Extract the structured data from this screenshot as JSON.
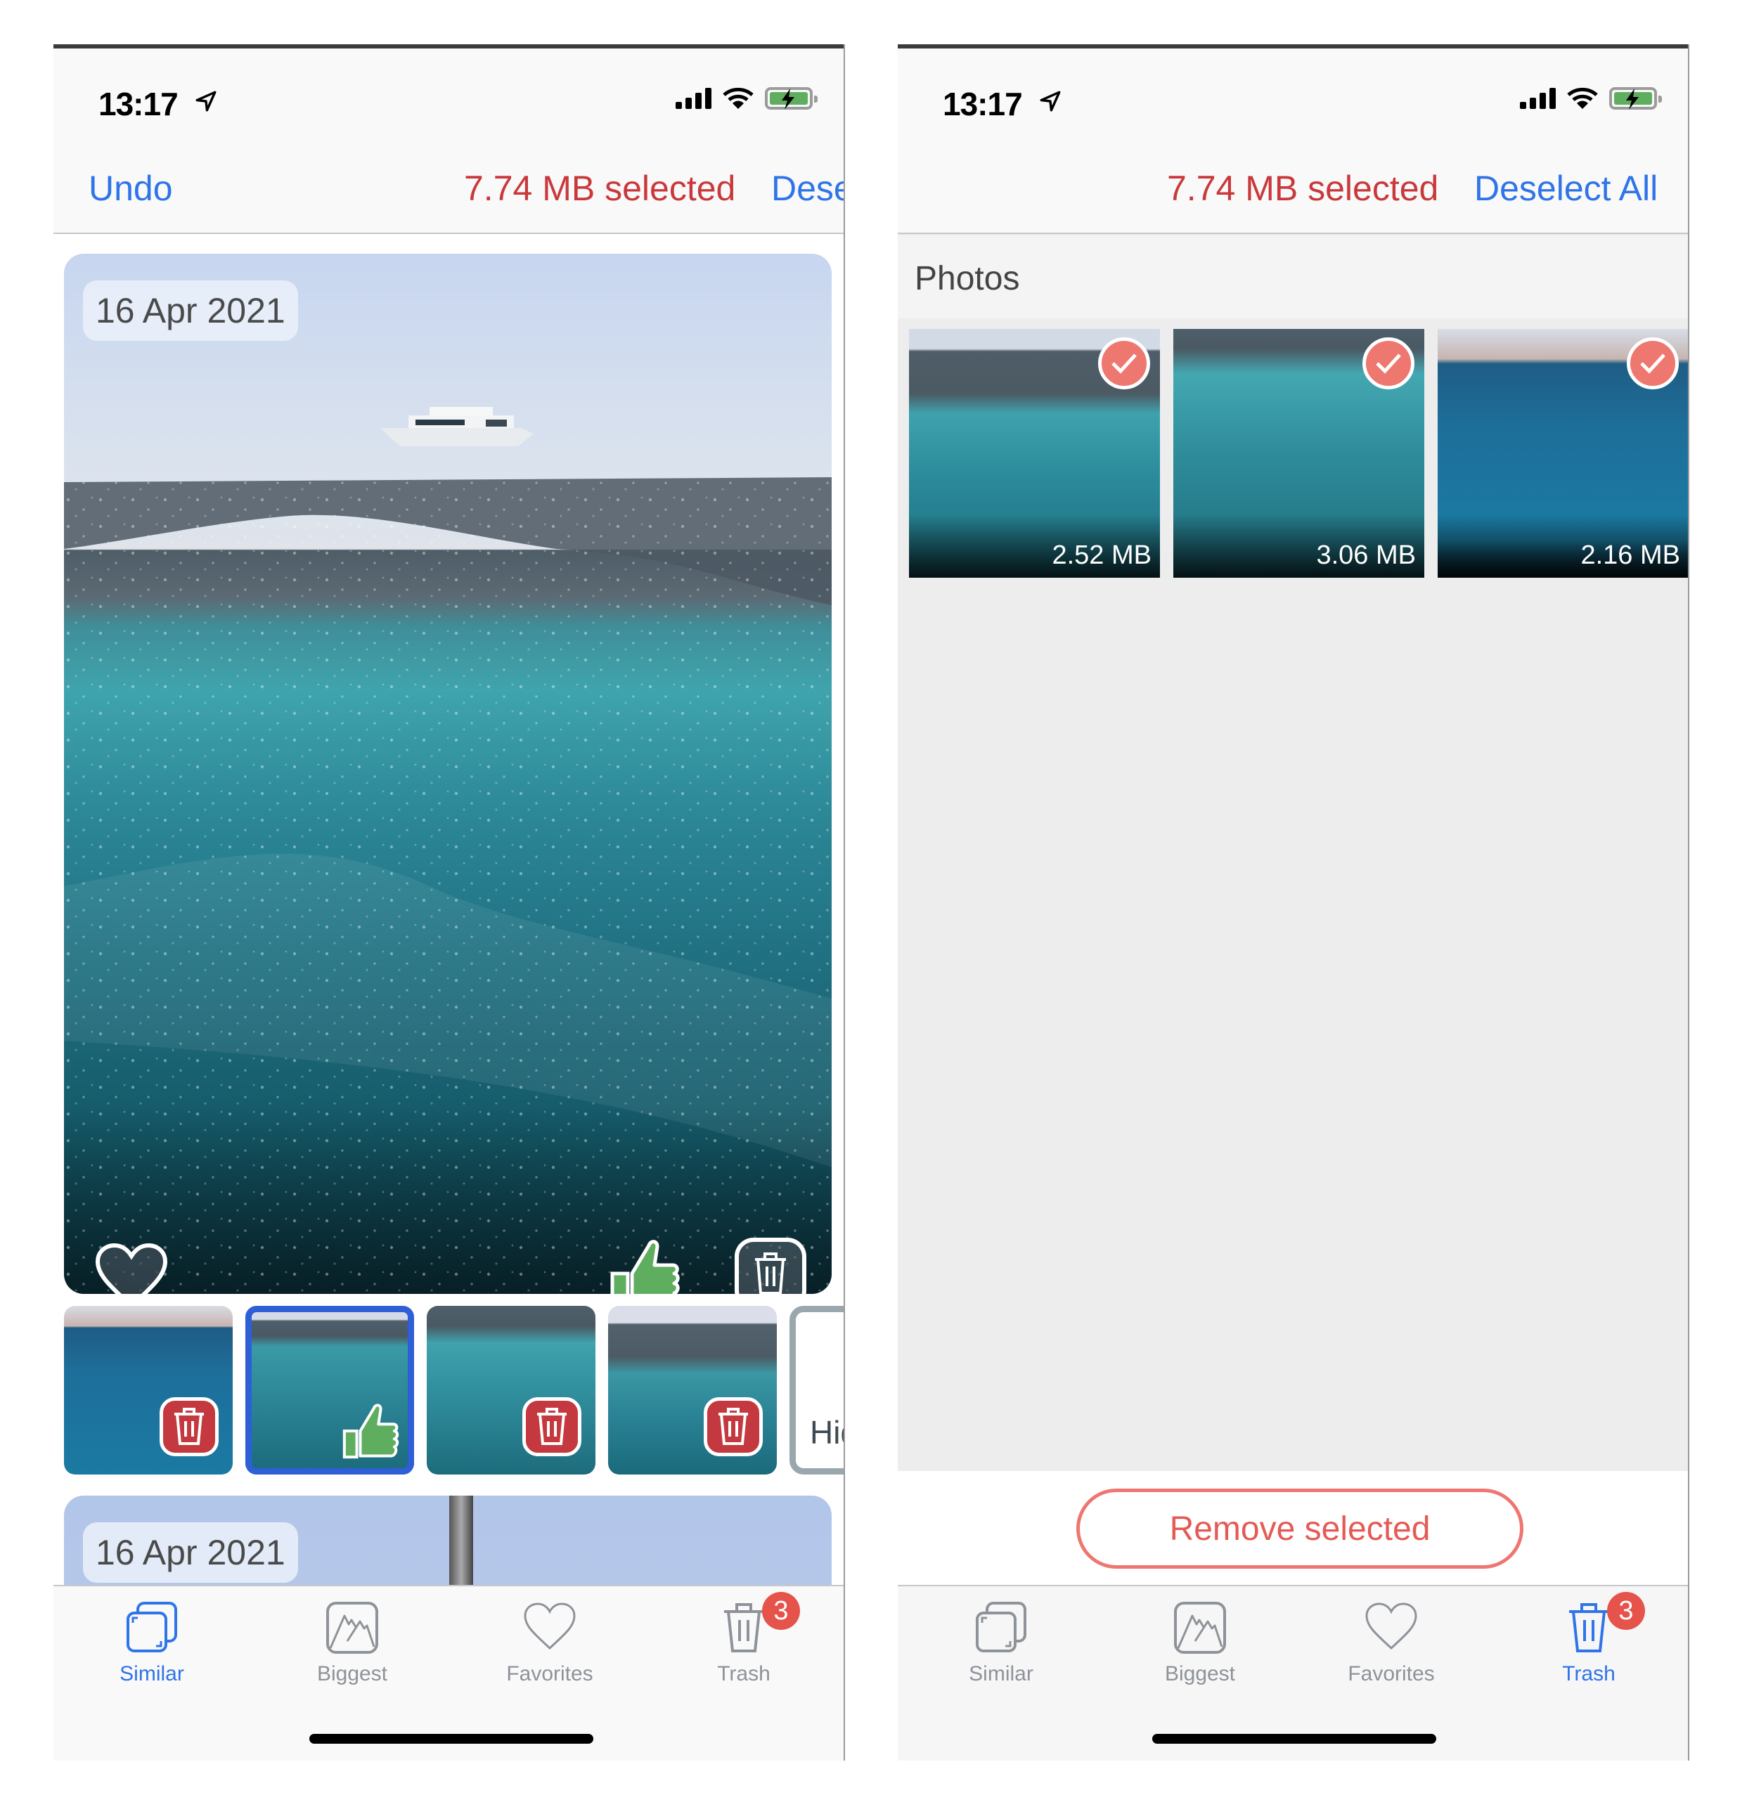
{
  "status_bar": {
    "time": "13:17",
    "location_icon": "location-arrow-icon",
    "signal_icon": "cellular-signal-icon",
    "wifi_icon": "wifi-icon",
    "battery_icon": "battery-charging-icon"
  },
  "colors": {
    "accent_blue": "#2f74e8",
    "selected_red": "#c9393c",
    "remove_red": "#e55a55",
    "check_red": "#ee7870",
    "badge_red": "#e5534b",
    "keep_green": "#5fae5f",
    "trash_badge_red": "#c4393f",
    "selected_border": "#2f5fd6",
    "inactive_gray": "#8e9399"
  },
  "left_screen": {
    "nav": {
      "undo_label": "Undo",
      "selected_size": "7.74 MB selected",
      "deselect_label": "Deselect All"
    },
    "cards": [
      {
        "date": "16 Apr 2021",
        "actions": [
          "favorite-heart",
          "keep-thumbs-up",
          "delete-trash"
        ]
      },
      {
        "date": "16 Apr 2021"
      }
    ],
    "thumbnails": [
      {
        "state": "trash",
        "selected": false
      },
      {
        "state": "keep",
        "selected": true
      },
      {
        "state": "trash",
        "selected": false
      },
      {
        "state": "trash",
        "selected": false
      }
    ],
    "hide_card_label": "Hid",
    "active_tab": "Similar"
  },
  "right_screen": {
    "nav": {
      "selected_size": "7.74 MB selected",
      "deselect_label": "Deselect All"
    },
    "section_title": "Photos",
    "photos": [
      {
        "size": "2.52 MB",
        "checked": true
      },
      {
        "size": "3.06 MB",
        "checked": true
      },
      {
        "size": "2.16 MB",
        "checked": true
      }
    ],
    "remove_button": "Remove selected",
    "active_tab": "Trash"
  },
  "tabs": [
    {
      "label": "Similar",
      "icon": "similar-stack-icon"
    },
    {
      "label": "Biggest",
      "icon": "image-mountains-icon"
    },
    {
      "label": "Favorites",
      "icon": "heart-icon"
    },
    {
      "label": "Trash",
      "icon": "trash-icon",
      "badge": "3"
    }
  ]
}
